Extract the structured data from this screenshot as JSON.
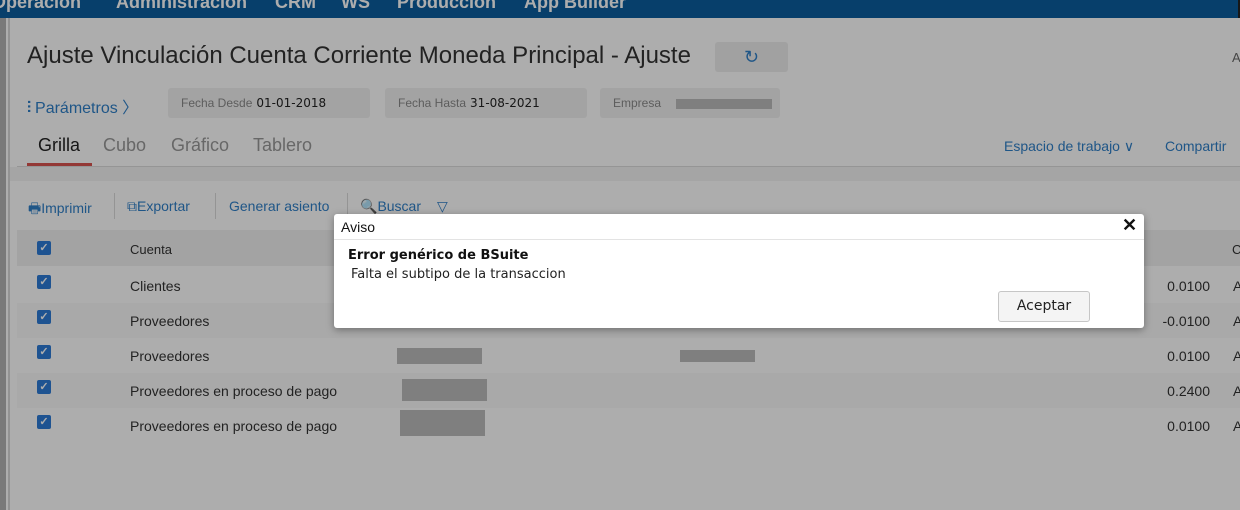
{
  "topnav": {
    "items": [
      "Operación",
      "Administración",
      "CRM",
      "WS",
      "Producción",
      "App Builder"
    ]
  },
  "header": {
    "title": "Ajuste Vinculación Cuenta Corriente Moneda Principal - Ajuste",
    "refresh_icon": "↻",
    "right_cut_text": "A"
  },
  "params": {
    "icon": "⫶",
    "label": "Parámetros",
    "chevron": "〉",
    "filters": [
      {
        "label": "Fecha Desde",
        "value": "01-01-2018"
      },
      {
        "label": "Fecha Hasta",
        "value": "31-08-2021"
      },
      {
        "label": "Empresa",
        "value": ""
      }
    ]
  },
  "tabs": [
    {
      "label": "Grilla",
      "active": true
    },
    {
      "label": "Cubo",
      "active": false
    },
    {
      "label": "Gráfico",
      "active": false
    },
    {
      "label": "Tablero",
      "active": false
    }
  ],
  "workspace": {
    "label": "Espacio de trabajo",
    "chevron": "∨",
    "share_label": "Compartir"
  },
  "toolbar": {
    "print_icon": "🖶",
    "print_label": "Imprimir",
    "export_icon": "⧉",
    "export_label": "Exportar",
    "post_label": "Generar asiento",
    "search_icon": "🔍",
    "search_label": "Buscar",
    "filter_icon": "▽"
  },
  "grid": {
    "columns": {
      "account": "Cuenta",
      "right_cut": "C"
    },
    "check": "✓",
    "rows": [
      {
        "account": "Clientes",
        "amount": "0.0100",
        "tail": "A"
      },
      {
        "account": "Proveedores",
        "amount": "-0.0100",
        "tail": "A"
      },
      {
        "account": "Proveedores",
        "amount": "0.0100",
        "tail": "A"
      },
      {
        "account": "Proveedores en proceso de pago",
        "amount": "0.2400",
        "tail": "A"
      },
      {
        "account": "Proveedores en proceso de pago",
        "amount": "0.0100",
        "tail": "A"
      }
    ]
  },
  "dialog": {
    "title": "Aviso",
    "close": "✕",
    "heading": "Error genérico de BSuite",
    "message": "Falta el subtipo de la transaccion",
    "accept_label": "Aceptar"
  }
}
